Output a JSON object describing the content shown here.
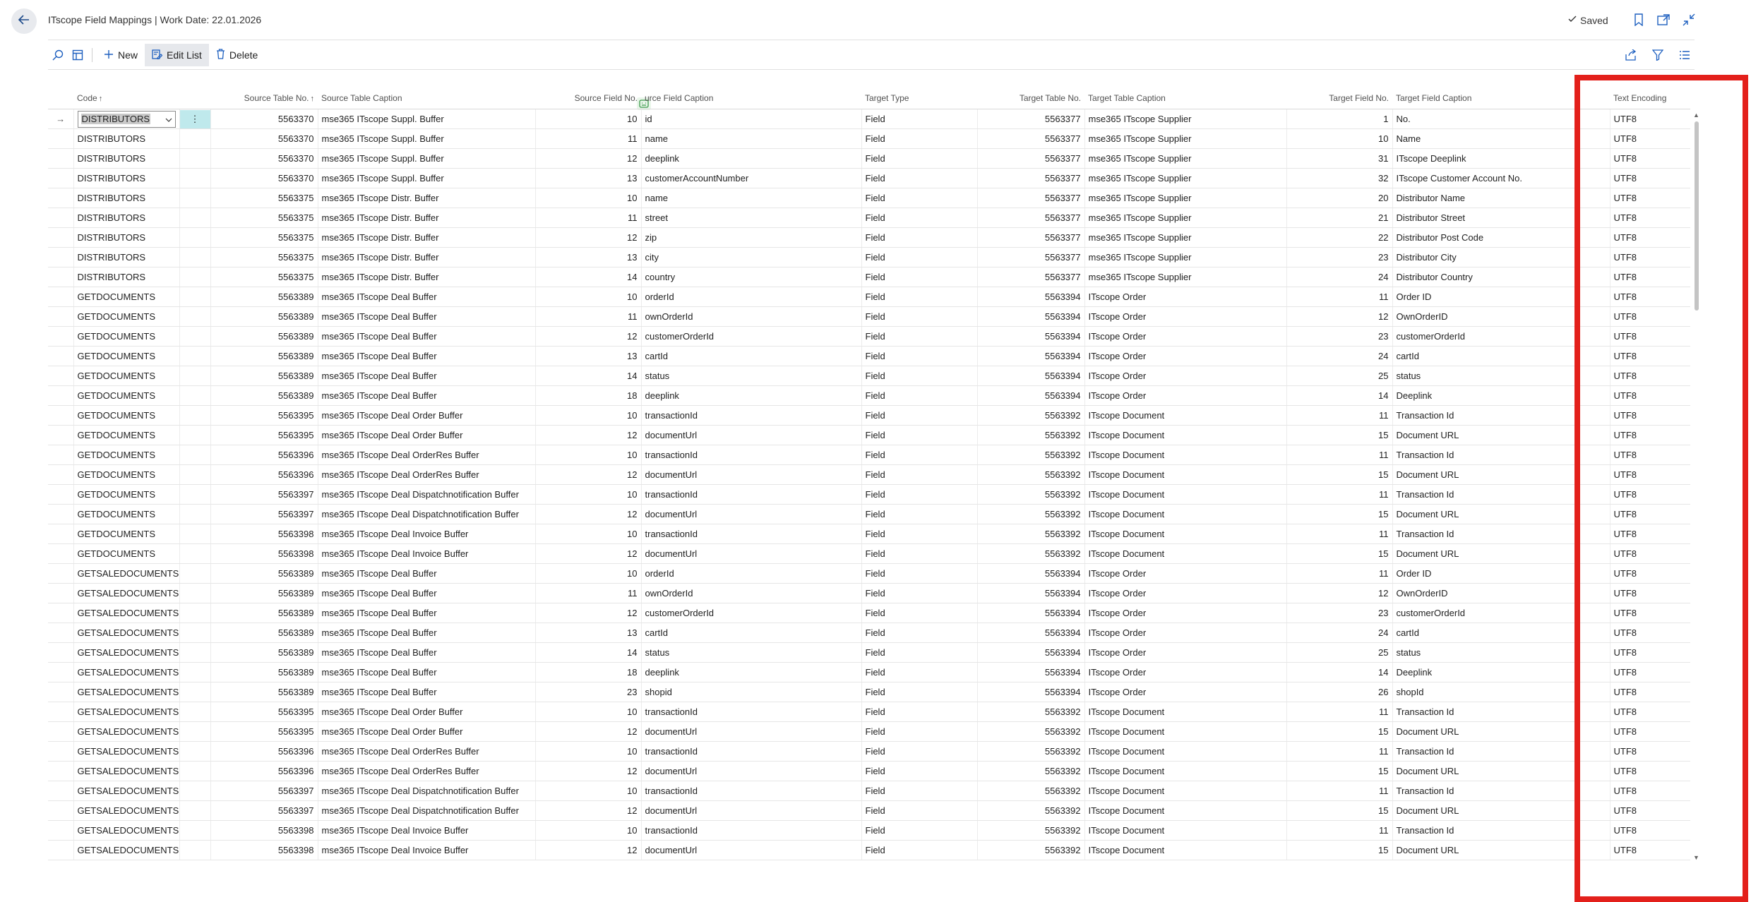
{
  "header": {
    "title": "ITscope Field Mappings | Work Date: 22.01.2026",
    "saved_label": "Saved"
  },
  "actions": {
    "new_label": "New",
    "edit_list_label": "Edit List",
    "delete_label": "Delete"
  },
  "icons": {
    "back": "back-arrow-icon",
    "search": "search-icon",
    "layout": "layout-icon",
    "bookmark": "bookmark-icon",
    "open_new": "open-in-new-window-icon",
    "collapse": "collapse-icon",
    "share": "share-icon",
    "filter": "filter-icon",
    "list": "list-options-icon"
  },
  "colors": {
    "highlight": "#e3201b",
    "selected_cell": "#bfe9ec"
  },
  "table": {
    "columns": {
      "code": "Code",
      "source_table_no": "Source Table No.",
      "source_table_caption": "Source Table Caption",
      "source_field_no": "Source Field No.",
      "source_field_caption": "urce Field Caption",
      "target_type": "Target Type",
      "target_table_no": "Target Table No.",
      "target_table_caption": "Target Table Caption",
      "target_field_no": "Target Field No.",
      "target_field_caption": "Target Field Caption",
      "text_encoding": "Text Encoding"
    },
    "rows": [
      {
        "code": "DISTRIBUTORS",
        "stn": "5563370",
        "stc": "mse365 ITscope Suppl. Buffer",
        "sfn": "10",
        "sfc": "id",
        "tt": "Field",
        "ttn": "5563377",
        "ttc": "mse365 ITscope Supplier",
        "tfn": "1",
        "tfc": "No.",
        "enc": "UTF8"
      },
      {
        "code": "DISTRIBUTORS",
        "stn": "5563370",
        "stc": "mse365 ITscope Suppl. Buffer",
        "sfn": "11",
        "sfc": "name",
        "tt": "Field",
        "ttn": "5563377",
        "ttc": "mse365 ITscope Supplier",
        "tfn": "10",
        "tfc": "Name",
        "enc": "UTF8"
      },
      {
        "code": "DISTRIBUTORS",
        "stn": "5563370",
        "stc": "mse365 ITscope Suppl. Buffer",
        "sfn": "12",
        "sfc": "deeplink",
        "tt": "Field",
        "ttn": "5563377",
        "ttc": "mse365 ITscope Supplier",
        "tfn": "31",
        "tfc": "ITscope Deeplink",
        "enc": "UTF8"
      },
      {
        "code": "DISTRIBUTORS",
        "stn": "5563370",
        "stc": "mse365 ITscope Suppl. Buffer",
        "sfn": "13",
        "sfc": "customerAccountNumber",
        "tt": "Field",
        "ttn": "5563377",
        "ttc": "mse365 ITscope Supplier",
        "tfn": "32",
        "tfc": "ITscope Customer Account No.",
        "enc": "UTF8"
      },
      {
        "code": "DISTRIBUTORS",
        "stn": "5563375",
        "stc": "mse365 ITscope Distr. Buffer",
        "sfn": "10",
        "sfc": "name",
        "tt": "Field",
        "ttn": "5563377",
        "ttc": "mse365 ITscope Supplier",
        "tfn": "20",
        "tfc": "Distributor Name",
        "enc": "UTF8"
      },
      {
        "code": "DISTRIBUTORS",
        "stn": "5563375",
        "stc": "mse365 ITscope Distr. Buffer",
        "sfn": "11",
        "sfc": "street",
        "tt": "Field",
        "ttn": "5563377",
        "ttc": "mse365 ITscope Supplier",
        "tfn": "21",
        "tfc": "Distributor Street",
        "enc": "UTF8"
      },
      {
        "code": "DISTRIBUTORS",
        "stn": "5563375",
        "stc": "mse365 ITscope Distr. Buffer",
        "sfn": "12",
        "sfc": "zip",
        "tt": "Field",
        "ttn": "5563377",
        "ttc": "mse365 ITscope Supplier",
        "tfn": "22",
        "tfc": "Distributor Post Code",
        "enc": "UTF8"
      },
      {
        "code": "DISTRIBUTORS",
        "stn": "5563375",
        "stc": "mse365 ITscope Distr. Buffer",
        "sfn": "13",
        "sfc": "city",
        "tt": "Field",
        "ttn": "5563377",
        "ttc": "mse365 ITscope Supplier",
        "tfn": "23",
        "tfc": "Distributor City",
        "enc": "UTF8"
      },
      {
        "code": "DISTRIBUTORS",
        "stn": "5563375",
        "stc": "mse365 ITscope Distr. Buffer",
        "sfn": "14",
        "sfc": "country",
        "tt": "Field",
        "ttn": "5563377",
        "ttc": "mse365 ITscope Supplier",
        "tfn": "24",
        "tfc": "Distributor Country",
        "enc": "UTF8"
      },
      {
        "code": "GETDOCUMENTS",
        "stn": "5563389",
        "stc": "mse365 ITscope Deal Buffer",
        "sfn": "10",
        "sfc": "orderId",
        "tt": "Field",
        "ttn": "5563394",
        "ttc": "ITscope Order",
        "tfn": "11",
        "tfc": "Order ID",
        "enc": "UTF8"
      },
      {
        "code": "GETDOCUMENTS",
        "stn": "5563389",
        "stc": "mse365 ITscope Deal Buffer",
        "sfn": "11",
        "sfc": "ownOrderId",
        "tt": "Field",
        "ttn": "5563394",
        "ttc": "ITscope Order",
        "tfn": "12",
        "tfc": "OwnOrderID",
        "enc": "UTF8"
      },
      {
        "code": "GETDOCUMENTS",
        "stn": "5563389",
        "stc": "mse365 ITscope Deal Buffer",
        "sfn": "12",
        "sfc": "customerOrderId",
        "tt": "Field",
        "ttn": "5563394",
        "ttc": "ITscope Order",
        "tfn": "23",
        "tfc": "customerOrderId",
        "enc": "UTF8"
      },
      {
        "code": "GETDOCUMENTS",
        "stn": "5563389",
        "stc": "mse365 ITscope Deal Buffer",
        "sfn": "13",
        "sfc": "cartId",
        "tt": "Field",
        "ttn": "5563394",
        "ttc": "ITscope Order",
        "tfn": "24",
        "tfc": "cartId",
        "enc": "UTF8"
      },
      {
        "code": "GETDOCUMENTS",
        "stn": "5563389",
        "stc": "mse365 ITscope Deal Buffer",
        "sfn": "14",
        "sfc": "status",
        "tt": "Field",
        "ttn": "5563394",
        "ttc": "ITscope Order",
        "tfn": "25",
        "tfc": "status",
        "enc": "UTF8"
      },
      {
        "code": "GETDOCUMENTS",
        "stn": "5563389",
        "stc": "mse365 ITscope Deal Buffer",
        "sfn": "18",
        "sfc": "deeplink",
        "tt": "Field",
        "ttn": "5563394",
        "ttc": "ITscope Order",
        "tfn": "14",
        "tfc": "Deeplink",
        "enc": "UTF8"
      },
      {
        "code": "GETDOCUMENTS",
        "stn": "5563395",
        "stc": "mse365 ITscope Deal Order Buffer",
        "sfn": "10",
        "sfc": "transactionId",
        "tt": "Field",
        "ttn": "5563392",
        "ttc": "ITscope Document",
        "tfn": "11",
        "tfc": "Transaction Id",
        "enc": "UTF8"
      },
      {
        "code": "GETDOCUMENTS",
        "stn": "5563395",
        "stc": "mse365 ITscope Deal Order Buffer",
        "sfn": "12",
        "sfc": "documentUrl",
        "tt": "Field",
        "ttn": "5563392",
        "ttc": "ITscope Document",
        "tfn": "15",
        "tfc": "Document URL",
        "enc": "UTF8"
      },
      {
        "code": "GETDOCUMENTS",
        "stn": "5563396",
        "stc": "mse365 ITscope Deal OrderRes Buffer",
        "sfn": "10",
        "sfc": "transactionId",
        "tt": "Field",
        "ttn": "5563392",
        "ttc": "ITscope Document",
        "tfn": "11",
        "tfc": "Transaction Id",
        "enc": "UTF8"
      },
      {
        "code": "GETDOCUMENTS",
        "stn": "5563396",
        "stc": "mse365 ITscope Deal OrderRes Buffer",
        "sfn": "12",
        "sfc": "documentUrl",
        "tt": "Field",
        "ttn": "5563392",
        "ttc": "ITscope Document",
        "tfn": "15",
        "tfc": "Document URL",
        "enc": "UTF8"
      },
      {
        "code": "GETDOCUMENTS",
        "stn": "5563397",
        "stc": "mse365 ITscope Deal Dispatchnotification Buffer",
        "sfn": "10",
        "sfc": "transactionId",
        "tt": "Field",
        "ttn": "5563392",
        "ttc": "ITscope Document",
        "tfn": "11",
        "tfc": "Transaction Id",
        "enc": "UTF8"
      },
      {
        "code": "GETDOCUMENTS",
        "stn": "5563397",
        "stc": "mse365 ITscope Deal Dispatchnotification Buffer",
        "sfn": "12",
        "sfc": "documentUrl",
        "tt": "Field",
        "ttn": "5563392",
        "ttc": "ITscope Document",
        "tfn": "15",
        "tfc": "Document URL",
        "enc": "UTF8"
      },
      {
        "code": "GETDOCUMENTS",
        "stn": "5563398",
        "stc": "mse365 ITscope Deal Invoice Buffer",
        "sfn": "10",
        "sfc": "transactionId",
        "tt": "Field",
        "ttn": "5563392",
        "ttc": "ITscope Document",
        "tfn": "11",
        "tfc": "Transaction Id",
        "enc": "UTF8"
      },
      {
        "code": "GETDOCUMENTS",
        "stn": "5563398",
        "stc": "mse365 ITscope Deal Invoice Buffer",
        "sfn": "12",
        "sfc": "documentUrl",
        "tt": "Field",
        "ttn": "5563392",
        "ttc": "ITscope Document",
        "tfn": "15",
        "tfc": "Document URL",
        "enc": "UTF8"
      },
      {
        "code": "GETSALEDOCUMENTS",
        "stn": "5563389",
        "stc": "mse365 ITscope Deal Buffer",
        "sfn": "10",
        "sfc": "orderId",
        "tt": "Field",
        "ttn": "5563394",
        "ttc": "ITscope Order",
        "tfn": "11",
        "tfc": "Order ID",
        "enc": "UTF8"
      },
      {
        "code": "GETSALEDOCUMENTS",
        "stn": "5563389",
        "stc": "mse365 ITscope Deal Buffer",
        "sfn": "11",
        "sfc": "ownOrderId",
        "tt": "Field",
        "ttn": "5563394",
        "ttc": "ITscope Order",
        "tfn": "12",
        "tfc": "OwnOrderID",
        "enc": "UTF8"
      },
      {
        "code": "GETSALEDOCUMENTS",
        "stn": "5563389",
        "stc": "mse365 ITscope Deal Buffer",
        "sfn": "12",
        "sfc": "customerOrderId",
        "tt": "Field",
        "ttn": "5563394",
        "ttc": "ITscope Order",
        "tfn": "23",
        "tfc": "customerOrderId",
        "enc": "UTF8"
      },
      {
        "code": "GETSALEDOCUMENTS",
        "stn": "5563389",
        "stc": "mse365 ITscope Deal Buffer",
        "sfn": "13",
        "sfc": "cartId",
        "tt": "Field",
        "ttn": "5563394",
        "ttc": "ITscope Order",
        "tfn": "24",
        "tfc": "cartId",
        "enc": "UTF8"
      },
      {
        "code": "GETSALEDOCUMENTS",
        "stn": "5563389",
        "stc": "mse365 ITscope Deal Buffer",
        "sfn": "14",
        "sfc": "status",
        "tt": "Field",
        "ttn": "5563394",
        "ttc": "ITscope Order",
        "tfn": "25",
        "tfc": "status",
        "enc": "UTF8"
      },
      {
        "code": "GETSALEDOCUMENTS",
        "stn": "5563389",
        "stc": "mse365 ITscope Deal Buffer",
        "sfn": "18",
        "sfc": "deeplink",
        "tt": "Field",
        "ttn": "5563394",
        "ttc": "ITscope Order",
        "tfn": "14",
        "tfc": "Deeplink",
        "enc": "UTF8"
      },
      {
        "code": "GETSALEDOCUMENTS",
        "stn": "5563389",
        "stc": "mse365 ITscope Deal Buffer",
        "sfn": "23",
        "sfc": "shopid",
        "tt": "Field",
        "ttn": "5563394",
        "ttc": "ITscope Order",
        "tfn": "26",
        "tfc": "shopId",
        "enc": "UTF8"
      },
      {
        "code": "GETSALEDOCUMENTS",
        "stn": "5563395",
        "stc": "mse365 ITscope Deal Order Buffer",
        "sfn": "10",
        "sfc": "transactionId",
        "tt": "Field",
        "ttn": "5563392",
        "ttc": "ITscope Document",
        "tfn": "11",
        "tfc": "Transaction Id",
        "enc": "UTF8"
      },
      {
        "code": "GETSALEDOCUMENTS",
        "stn": "5563395",
        "stc": "mse365 ITscope Deal Order Buffer",
        "sfn": "12",
        "sfc": "documentUrl",
        "tt": "Field",
        "ttn": "5563392",
        "ttc": "ITscope Document",
        "tfn": "15",
        "tfc": "Document URL",
        "enc": "UTF8"
      },
      {
        "code": "GETSALEDOCUMENTS",
        "stn": "5563396",
        "stc": "mse365 ITscope Deal OrderRes Buffer",
        "sfn": "10",
        "sfc": "transactionId",
        "tt": "Field",
        "ttn": "5563392",
        "ttc": "ITscope Document",
        "tfn": "11",
        "tfc": "Transaction Id",
        "enc": "UTF8"
      },
      {
        "code": "GETSALEDOCUMENTS",
        "stn": "5563396",
        "stc": "mse365 ITscope Deal OrderRes Buffer",
        "sfn": "12",
        "sfc": "documentUrl",
        "tt": "Field",
        "ttn": "5563392",
        "ttc": "ITscope Document",
        "tfn": "15",
        "tfc": "Document URL",
        "enc": "UTF8"
      },
      {
        "code": "GETSALEDOCUMENTS",
        "stn": "5563397",
        "stc": "mse365 ITscope Deal Dispatchnotification Buffer",
        "sfn": "10",
        "sfc": "transactionId",
        "tt": "Field",
        "ttn": "5563392",
        "ttc": "ITscope Document",
        "tfn": "11",
        "tfc": "Transaction Id",
        "enc": "UTF8"
      },
      {
        "code": "GETSALEDOCUMENTS",
        "stn": "5563397",
        "stc": "mse365 ITscope Deal Dispatchnotification Buffer",
        "sfn": "12",
        "sfc": "documentUrl",
        "tt": "Field",
        "ttn": "5563392",
        "ttc": "ITscope Document",
        "tfn": "15",
        "tfc": "Document URL",
        "enc": "UTF8"
      },
      {
        "code": "GETSALEDOCUMENTS",
        "stn": "5563398",
        "stc": "mse365 ITscope Deal Invoice Buffer",
        "sfn": "10",
        "sfc": "transactionId",
        "tt": "Field",
        "ttn": "5563392",
        "ttc": "ITscope Document",
        "tfn": "11",
        "tfc": "Transaction Id",
        "enc": "UTF8"
      },
      {
        "code": "GETSALEDOCUMENTS",
        "stn": "5563398",
        "stc": "mse365 ITscope Deal Invoice Buffer",
        "sfn": "12",
        "sfc": "documentUrl",
        "tt": "Field",
        "ttn": "5563392",
        "ttc": "ITscope Document",
        "tfn": "15",
        "tfc": "Document URL",
        "enc": "UTF8"
      }
    ]
  }
}
